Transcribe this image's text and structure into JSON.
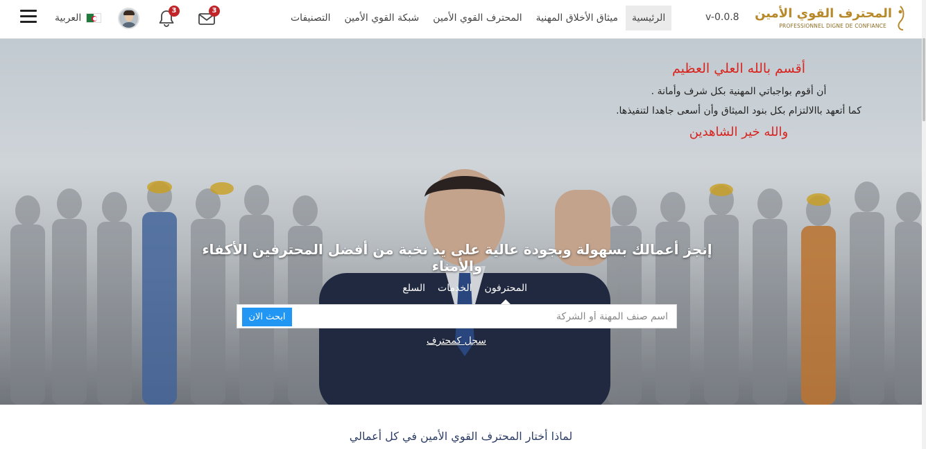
{
  "nav": {
    "language": "العربية",
    "notifications_count": "3",
    "messages_count": "3",
    "links": [
      {
        "label": "التصنيفات"
      },
      {
        "label": "شبكة القوي الأمين"
      },
      {
        "label": "المحترف القوي الأمين"
      },
      {
        "label": "ميثاق الأخلاق المهنية"
      },
      {
        "label": "الرئيسية"
      }
    ],
    "version": "v-0.0.8",
    "logo_ar": "المحترف القوي الأمين",
    "logo_fr": "PROFESSIONNEL DIGNE DE CONFIANCE"
  },
  "hero": {
    "oath_title": "أقسم بالله العلي العظيم",
    "oath_line1": "أن أقوم بواجباتي المهنية بكل شرف وأمانة .",
    "oath_line2": "كما أتعهد باالالتزام بكل بنود الميثاق وأن أسعى جاهدا لتنفيذها.",
    "oath_end": "والله خير الشاهدين",
    "headline": "إنجز أعمالك بسهولة وبجودة عالية على يد نخبة من أفضل المحترفين الأكفاء والأمناء",
    "tabs": [
      "المحترفون",
      "الخدمات",
      "السلع"
    ],
    "search_placeholder": "اسم صنف المهنة أو الشركة",
    "search_button": "ابحث الان",
    "register_link": "سجل كمحترف"
  },
  "why": {
    "title": "لماذا أختار المحترف القوي الأمين في كل أعمالي"
  },
  "colors": {
    "accent": "#2196f3",
    "oath_red": "#d8241f",
    "badge": "#c0252a"
  }
}
